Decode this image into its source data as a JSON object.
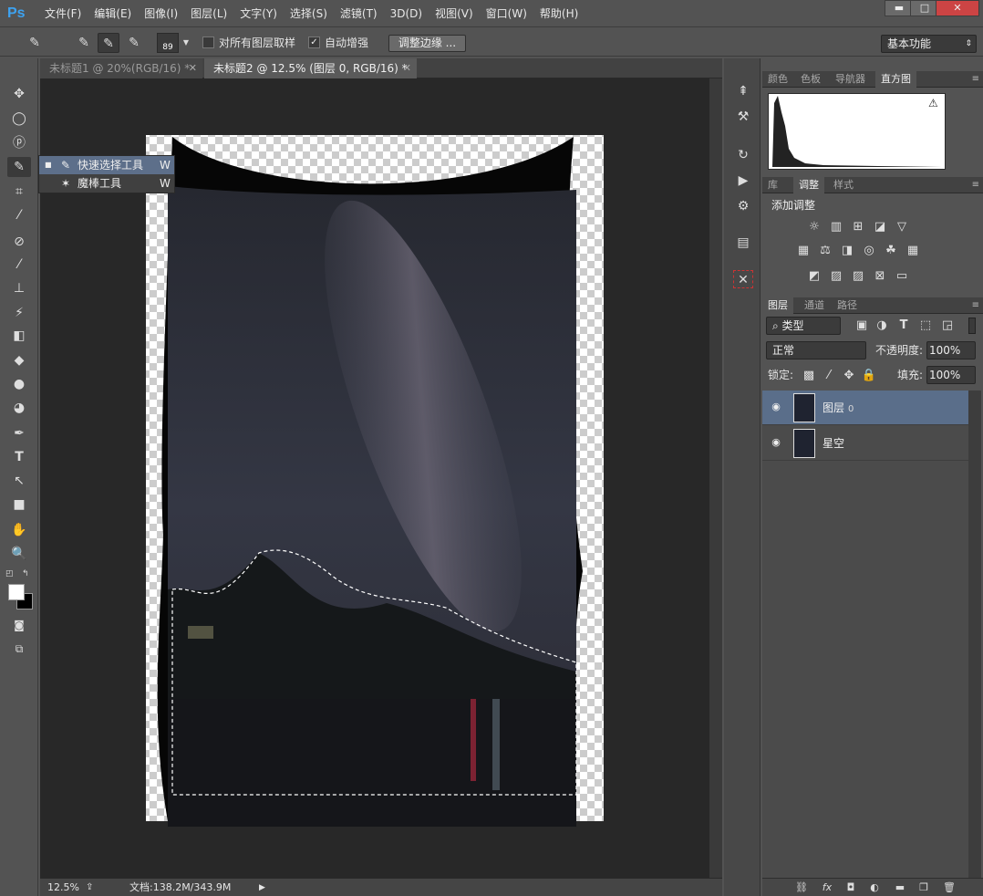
{
  "app": {
    "logo": "Ps"
  },
  "menu": [
    "文件(F)",
    "编辑(E)",
    "图像(I)",
    "图层(L)",
    "文字(Y)",
    "选择(S)",
    "滤镜(T)",
    "3D(D)",
    "视图(V)",
    "窗口(W)",
    "帮助(H)"
  ],
  "window_controls": {
    "minimize": "▬",
    "maximize": "□",
    "close": "✕"
  },
  "options": {
    "brush_size": "89",
    "sample_all_layers": "对所有图层取样",
    "sample_all_checked": "",
    "auto_enhance": "自动增强",
    "auto_enhance_checked": "✓",
    "refine_edge": "调整边缘 ...",
    "workspace": "基本功能"
  },
  "flyout": {
    "items": [
      {
        "label": "快速选择工具",
        "key": "W",
        "selected": true
      },
      {
        "label": "魔棒工具",
        "key": "W",
        "selected": false
      }
    ]
  },
  "tabs": [
    {
      "label": "未标题1 @ 20%(RGB/16) *",
      "active": false
    },
    {
      "label": "未标题2 @ 12.5% (图层 0, RGB/16) *",
      "active": true
    }
  ],
  "status": {
    "zoom": "12.5%",
    "doc": "文档:138.2M/343.9M"
  },
  "panel_group1": {
    "tabs": [
      "颜色",
      "色板",
      "导航器",
      "直方图"
    ],
    "active": "直方图"
  },
  "panel_group2": {
    "tabs": [
      "库",
      "调整",
      "样式"
    ],
    "active": "调整",
    "title": "添加调整"
  },
  "panel_group3": {
    "tabs": [
      "图层",
      "通道",
      "路径"
    ],
    "active": "图层"
  },
  "layers_panel": {
    "filter": "类型",
    "blend_mode": "正常",
    "opacity_label": "不透明度:",
    "opacity": "100%",
    "lock_label": "锁定:",
    "fill_label": "填充:",
    "fill": "100%",
    "layers": [
      {
        "name": "图层",
        "suffix": "0",
        "selected": true
      },
      {
        "name": "星空",
        "suffix": "",
        "selected": false
      }
    ]
  },
  "footer_icons": [
    "link-icon",
    "fx-icon",
    "mask-icon",
    "adjustment-icon",
    "folder-icon",
    "new-layer-icon",
    "trash-icon"
  ]
}
